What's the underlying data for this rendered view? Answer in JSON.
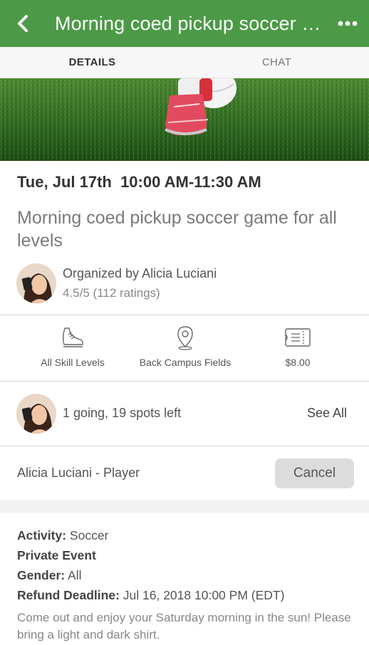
{
  "header": {
    "title": "Morning coed pickup soccer ga...",
    "back_icon": "chevron-left-icon",
    "more_icon": "more-horizontal-icon",
    "color": "#4c9a47"
  },
  "tabs": [
    {
      "label": "DETAILS",
      "active": true
    },
    {
      "label": "CHAT",
      "active": false
    }
  ],
  "event": {
    "datetime": "Tue, Jul 17th  10:00 AM-11:30 AM",
    "title": "Morning coed pickup soccer game for all levels"
  },
  "organizer": {
    "label": "Organized by Alicia Luciani",
    "rating": "4.5/5 (112 ratings)"
  },
  "info": [
    {
      "icon": "sneaker-icon",
      "label": "All Skill Levels"
    },
    {
      "icon": "location-pin-icon",
      "label": "Back Campus Fields"
    },
    {
      "icon": "ticket-icon",
      "label": "$8.00"
    }
  ],
  "attendance": {
    "text": "1 going, 19 spots left",
    "see_all": "See All"
  },
  "registration": {
    "player": "Alicia Luciani - Player",
    "cancel_label": "Cancel"
  },
  "details": {
    "activity_key": "Activity:",
    "activity_value": "Soccer",
    "privacy": "Private Event",
    "gender_key": "Gender:",
    "gender_value": "All",
    "refund_key": "Refund Deadline:",
    "refund_value": "Jul 16, 2018 10:00 PM (EDT)"
  },
  "description": "Come out and enjoy your Saturday morning in the sun! Please bring a light and dark shirt."
}
